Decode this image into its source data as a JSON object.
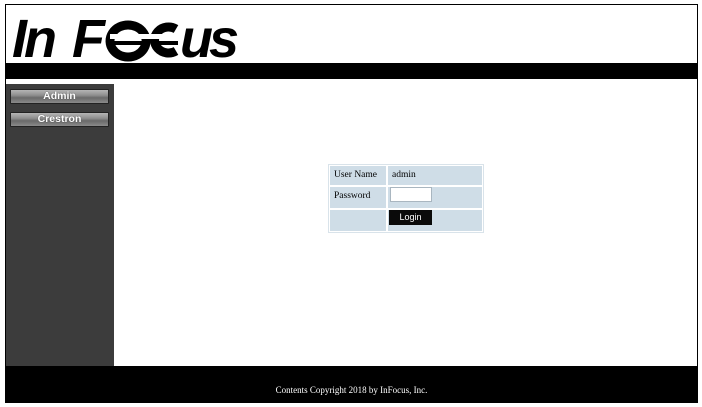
{
  "header": {
    "logo_text": "InFocus"
  },
  "sidebar": {
    "items": [
      {
        "label": "Admin"
      },
      {
        "label": "Crestron"
      }
    ]
  },
  "login": {
    "username_label": "User Name",
    "username_value": "admin",
    "password_label": "Password",
    "password_value": "",
    "login_button": "Login"
  },
  "footer": {
    "copyright": "Contents Copyright 2018 by InFocus, Inc."
  }
}
